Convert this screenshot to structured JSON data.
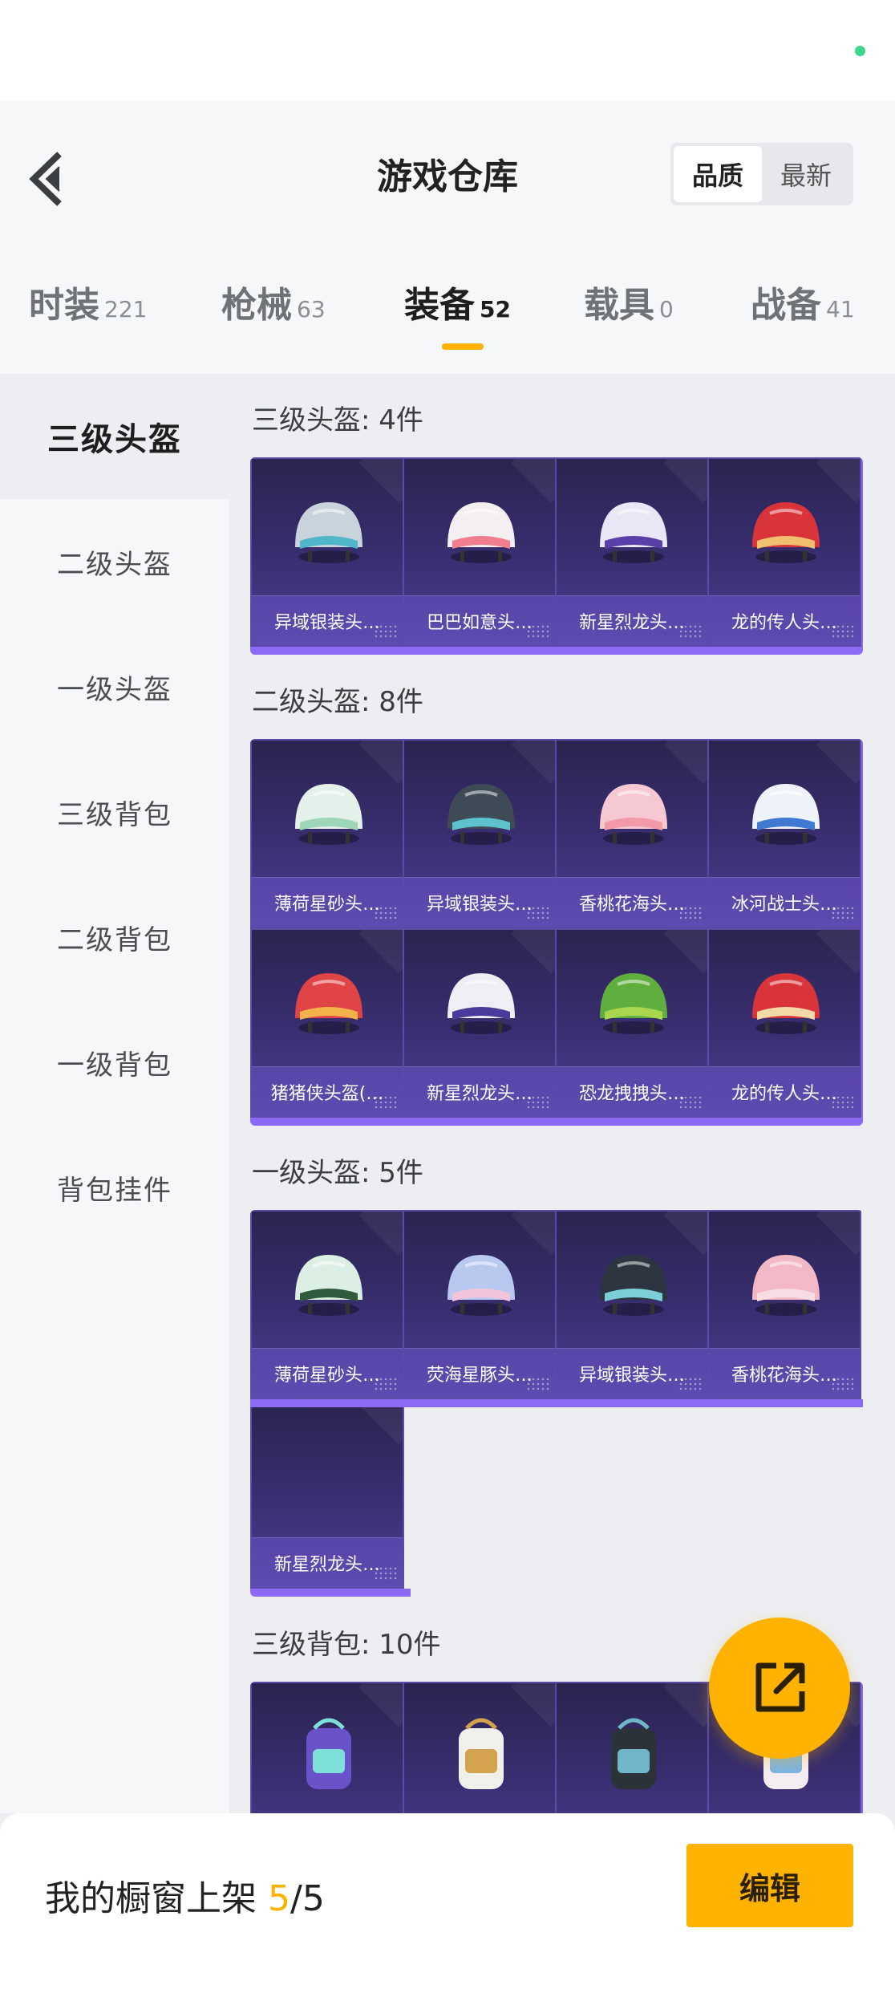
{
  "header": {
    "title": "游戏仓库",
    "sort_options": [
      "品质",
      "最新"
    ],
    "sort_active": "品质"
  },
  "tabs": [
    {
      "label": "时装",
      "count": "221"
    },
    {
      "label": "枪械",
      "count": "63"
    },
    {
      "label": "装备",
      "count": "52",
      "active": true
    },
    {
      "label": "载具",
      "count": "0"
    },
    {
      "label": "战备",
      "count": "41"
    }
  ],
  "sidebar": {
    "items": [
      "三级头盔",
      "二级头盔",
      "一级头盔",
      "三级背包",
      "二级背包",
      "一级背包",
      "背包挂件"
    ],
    "active": "三级头盔"
  },
  "sections": [
    {
      "title": "三级头盔: 4件",
      "items": [
        "异域银装头…",
        "巴巴如意头…",
        "新星烈龙头…",
        "龙的传人头…"
      ]
    },
    {
      "title": "二级头盔: 8件",
      "items": [
        "薄荷星砂头…",
        "异域银装头…",
        "香桃花海头…",
        "冰河战士头…",
        "猪猪侠头盔(…",
        "新星烈龙头…",
        "恐龙拽拽头…",
        "龙的传人头…"
      ]
    },
    {
      "title": "一级头盔: 5件",
      "items": [
        "薄荷星砂头…",
        "荧海星豚头…",
        "异域银装头…",
        "香桃花海头…",
        "新星烈龙头…"
      ]
    },
    {
      "title": "三级背包: 10件",
      "items": [
        "",
        "",
        "",
        ""
      ]
    }
  ],
  "item_icons": {
    "s0": [
      "helmet-silver",
      "helmet-white-pink",
      "helmet-purple-dragon",
      "helmet-red-dragon"
    ],
    "s1": [
      "helmet-mint",
      "helmet-silver-teal",
      "helmet-pink",
      "helmet-ice-blue",
      "helmet-pig",
      "helmet-dragon-white",
      "helmet-frog",
      "helmet-red"
    ],
    "s2": [
      "helmet-mint-open",
      "helmet-dolphin",
      "helmet-silver-black",
      "helmet-pink-open",
      ""
    ],
    "s3": [
      "backpack-purple",
      "backpack-white",
      "backpack-black",
      "backpack-rabbit"
    ]
  },
  "colors": {
    "accent": "#ffb300",
    "card_bg": "#3a2f72",
    "card_border": "#8d6af5"
  },
  "footer": {
    "label": "我的橱窗上架",
    "count_current": "5",
    "count_total": "/5",
    "edit_label": "编辑"
  }
}
